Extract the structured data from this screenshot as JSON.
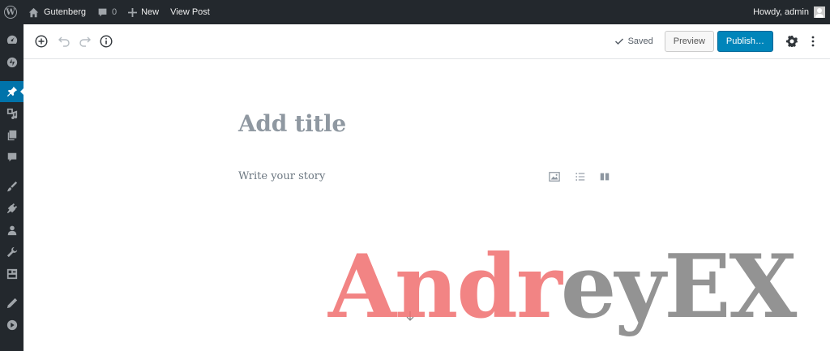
{
  "adminbar": {
    "site_name": "Gutenberg",
    "comments_count": "0",
    "new_label": "New",
    "view_post_label": "View Post",
    "howdy": "Howdy, admin"
  },
  "sidebar": {
    "items": [
      {
        "name": "dashboard-icon"
      },
      {
        "name": "jetpack-icon"
      },
      {
        "name": "posts-icon",
        "active": true
      },
      {
        "name": "media-icon"
      },
      {
        "name": "pages-icon"
      },
      {
        "name": "comments-icon"
      },
      {
        "name": "appearance-icon"
      },
      {
        "name": "plugins-icon"
      },
      {
        "name": "users-icon"
      },
      {
        "name": "tools-icon"
      },
      {
        "name": "settings-icon"
      },
      {
        "name": "edit-icon"
      },
      {
        "name": "collapse-icon"
      }
    ]
  },
  "header": {
    "saved_label": "Saved",
    "preview_label": "Preview",
    "publish_label": "Publish…"
  },
  "editor": {
    "title_placeholder": "Add title",
    "body_placeholder": "Write your story"
  },
  "watermark": {
    "part_red": "Andr",
    "part_grey": "eyEX"
  },
  "colors": {
    "admin_bar": "#23282d",
    "accent": "#0073aa",
    "publish": "#0085ba"
  }
}
